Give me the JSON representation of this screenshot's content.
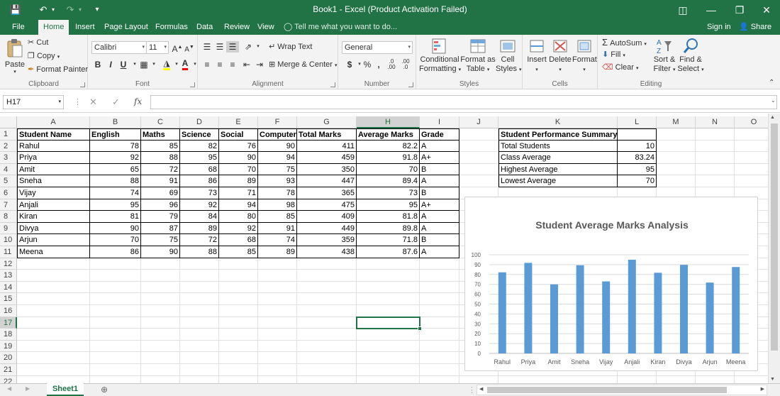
{
  "titlebar": {
    "title": "Book1  -  Excel (Product Activation Failed)",
    "save_icon": "save-icon",
    "undo_icon": "undo-icon",
    "redo_icon": "redo-icon",
    "customize_icon": "customize-toolbar-icon"
  },
  "tabs": [
    {
      "label": "File",
      "active": false
    },
    {
      "label": "Home",
      "active": true
    },
    {
      "label": "Insert",
      "active": false
    },
    {
      "label": "Page Layout",
      "active": false
    },
    {
      "label": "Formulas",
      "active": false
    },
    {
      "label": "Data",
      "active": false
    },
    {
      "label": "Review",
      "active": false
    },
    {
      "label": "View",
      "active": false
    }
  ],
  "tell_me": "Tell me what you want to do...",
  "sign_in": "Sign in",
  "share": "Share",
  "ribbon": {
    "clipboard": {
      "paste": "Paste",
      "cut": "Cut",
      "copy": "Copy",
      "format_painter": "Format Painter",
      "label": "Clipboard"
    },
    "font": {
      "name": "Calibri",
      "size": "11",
      "label": "Font",
      "bold": "B",
      "italic": "I",
      "underline": "U"
    },
    "alignment": {
      "wrap": "Wrap Text",
      "merge": "Merge & Center",
      "label": "Alignment"
    },
    "number": {
      "format": "General",
      "currency": "$",
      "percent": "%",
      "comma": ",",
      "label": "Number"
    },
    "styles": {
      "conditional": "Conditional",
      "conditional2": "Formatting",
      "format_as": "Format as",
      "format_as2": "Table",
      "cell": "Cell",
      "cell2": "Styles",
      "label": "Styles"
    },
    "cells": {
      "insert": "Insert",
      "delete": "Delete",
      "format": "Format",
      "label": "Cells"
    },
    "editing": {
      "autosum": "AutoSum",
      "fill": "Fill",
      "clear": "Clear",
      "sort": "Sort &",
      "sort2": "Filter",
      "find": "Find &",
      "find2": "Select",
      "label": "Editing"
    }
  },
  "formula_bar": {
    "name_box": "H17",
    "fx": "fx",
    "value": ""
  },
  "columns": [
    "A",
    "B",
    "C",
    "D",
    "E",
    "F",
    "G",
    "H",
    "I",
    "J",
    "K",
    "L",
    "M",
    "N",
    "O"
  ],
  "selected_column": "H",
  "selected_row": 17,
  "rows": [
    "1",
    "2",
    "3",
    "4",
    "5",
    "6",
    "7",
    "8",
    "9",
    "10",
    "11",
    "12",
    "13",
    "14",
    "15",
    "16",
    "17",
    "18",
    "19",
    "20",
    "21",
    "22"
  ],
  "table_headers": [
    "Student Name",
    "English",
    "Maths",
    "Science",
    "Social",
    "Computer",
    "Total Marks",
    "Average Marks",
    "Grade"
  ],
  "students": [
    [
      "Rahul",
      "78",
      "85",
      "82",
      "76",
      "90",
      "411",
      "82.2",
      "A"
    ],
    [
      "Priya",
      "92",
      "88",
      "95",
      "90",
      "94",
      "459",
      "91.8",
      "A+"
    ],
    [
      "Amit",
      "65",
      "72",
      "68",
      "70",
      "75",
      "350",
      "70",
      "B"
    ],
    [
      "Sneha",
      "88",
      "91",
      "86",
      "89",
      "93",
      "447",
      "89.4",
      "A"
    ],
    [
      "Vijay",
      "74",
      "69",
      "73",
      "71",
      "78",
      "365",
      "73",
      "B"
    ],
    [
      "Anjali",
      "95",
      "96",
      "92",
      "94",
      "98",
      "475",
      "95",
      "A+"
    ],
    [
      "Kiran",
      "81",
      "79",
      "84",
      "80",
      "85",
      "409",
      "81.8",
      "A"
    ],
    [
      "Divya",
      "90",
      "87",
      "89",
      "92",
      "91",
      "449",
      "89.8",
      "A"
    ],
    [
      "Arjun",
      "70",
      "75",
      "72",
      "68",
      "74",
      "359",
      "71.8",
      "B"
    ],
    [
      "Meena",
      "86",
      "90",
      "88",
      "85",
      "89",
      "438",
      "87.6",
      "A"
    ]
  ],
  "summary": {
    "title": "Student Performance Summary",
    "rows": [
      [
        "Total Students",
        "10"
      ],
      [
        "Class Average",
        "83.24"
      ],
      [
        "Highest Average",
        "95"
      ],
      [
        "Lowest Average",
        "70"
      ]
    ]
  },
  "chart_data": {
    "type": "bar",
    "title": "Student Average Marks Analysis",
    "categories": [
      "Rahul",
      "Priya",
      "Amit",
      "Sneha",
      "Vijay",
      "Anjali",
      "Kiran",
      "Divya",
      "Arjun",
      "Meena"
    ],
    "values": [
      82.2,
      91.8,
      70,
      89.4,
      73,
      95,
      81.8,
      89.8,
      71.8,
      87.6
    ],
    "ylim": [
      0,
      100
    ],
    "yticks": [
      "0",
      "10",
      "20",
      "30",
      "40",
      "50",
      "60",
      "70",
      "80",
      "90",
      "100"
    ],
    "xlabel": "",
    "ylabel": "",
    "grid": true,
    "bar_color": "#5b9bd5"
  },
  "sheet_tab": "Sheet1",
  "colors": {
    "accent": "#217346",
    "bar": "#5b9bd5"
  }
}
